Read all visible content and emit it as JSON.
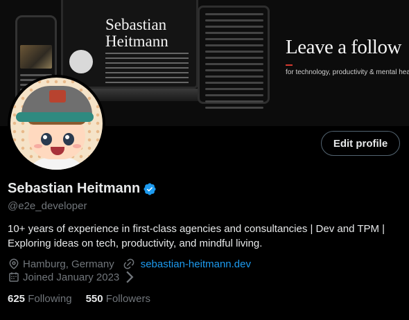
{
  "banner": {
    "mini_name_line1": "Sebastian",
    "mini_name_line2": "Heitmann",
    "title": "Leave a follow",
    "subtitle": "for technology, productivity & mental health"
  },
  "profile": {
    "edit_button_label": "Edit profile",
    "name": "Sebastian Heitmann",
    "handle": "@e2e_developer",
    "bio_line1": "10+ years of experience in first-class agencies and consultancies | Dev and TPM |",
    "bio_line2": "Exploring ideas on tech, productivity, and mindful living.",
    "location": "Hamburg, Germany",
    "website": "sebastian-heitmann.dev",
    "joined": "Joined January 2023",
    "following_count": "625",
    "following_label": "Following",
    "followers_count": "550",
    "followers_label": "Followers"
  },
  "colors": {
    "background": "#000000",
    "text_primary": "#e7e9ea",
    "text_secondary": "#71767b",
    "link": "#1d9bf0",
    "verified": "#1d9bf0",
    "button_border": "#536471"
  },
  "icons": [
    "verified-badge-icon",
    "location-pin-icon",
    "link-icon",
    "calendar-icon",
    "chevron-right-icon"
  ]
}
